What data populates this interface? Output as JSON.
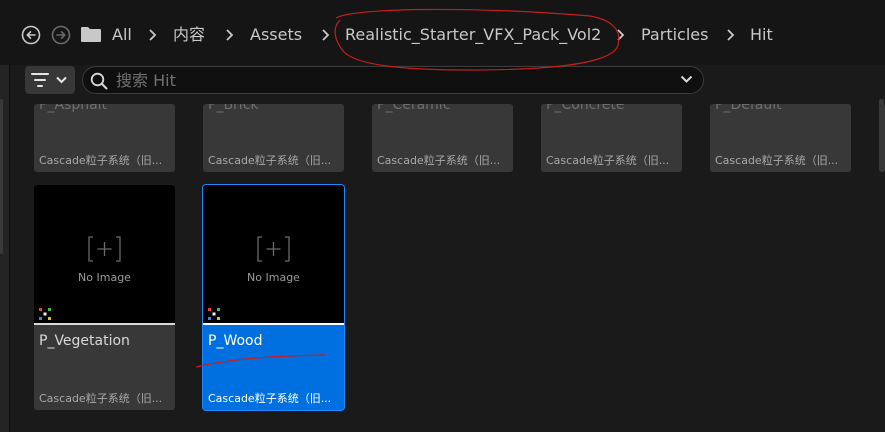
{
  "breadcrumb": {
    "items": [
      "All",
      "内容",
      "Assets",
      "Realistic_Starter_VFX_Pack_Vol2",
      "Particles",
      "Hit"
    ]
  },
  "search": {
    "placeholder": "搜索 Hit",
    "value": ""
  },
  "assets": {
    "partial_row": [
      {
        "name": "P_Asphalt",
        "type": "Cascade粒子系统（旧..."
      },
      {
        "name": "P_Brick",
        "type": "Cascade粒子系统（旧..."
      },
      {
        "name": "P_Ceramic",
        "type": "Cascade粒子系统（旧..."
      },
      {
        "name": "P_Concrete",
        "type": "Cascade粒子系统（旧..."
      },
      {
        "name": "P_Default",
        "type": "Cascade粒子系统（旧..."
      }
    ],
    "full_row": [
      {
        "name": "P_Vegetation",
        "type": "Cascade粒子系统（旧...",
        "thumb_text": "No Image",
        "selected": false
      },
      {
        "name": "P_Wood",
        "type": "Cascade粒子系统（旧...",
        "thumb_text": "No Image",
        "selected": true
      }
    ]
  },
  "colors": {
    "selection": "#0070e0",
    "annotation": "#d42020",
    "background": "#1a1a1a",
    "tile": "#383838"
  },
  "icons": [
    "back-arrow-icon",
    "forward-arrow-icon",
    "folder-icon",
    "chevron-right-icon",
    "filter-icon",
    "chevron-down-icon",
    "search-icon",
    "no-image-icon",
    "particle-system-icon"
  ]
}
